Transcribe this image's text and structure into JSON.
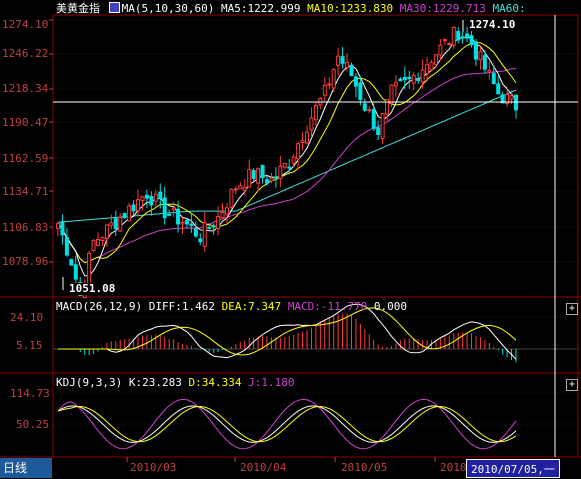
{
  "header": {
    "symbol_name": "美黄金指",
    "ma_label": "MA(5,10,30,60)",
    "ma5": "MA5:1222.999",
    "ma10": "MA10:1233.830",
    "ma30": "MA30:1229.713",
    "ma60": "MA60:"
  },
  "macd_header": {
    "name": "MACD(26,12,9)",
    "diff": "DIFF:1.462",
    "dea": "DEA:7.347",
    "macd": "MACD:-11.770",
    "extra": "0.000"
  },
  "kdj_header": {
    "name": "KDJ(9,3,3)",
    "k": "K:23.283",
    "d": "D:34.334",
    "j": "J:1.180"
  },
  "price_axis": [
    "1274.10",
    "1246.22",
    "1218.34",
    "1190.47",
    "1162.59",
    "1134.71",
    "1106.83",
    "1078.96"
  ],
  "macd_axis": [
    "24.10",
    "5.15"
  ],
  "kdj_axis": [
    "114.73",
    "50.25"
  ],
  "annotations": {
    "high": "1274.10",
    "low": "1051.08"
  },
  "footer": {
    "period": "日线",
    "dates": [
      "2010/03",
      "2010/04",
      "2010/05",
      "2010"
    ],
    "cursor_date": "2010/07/05,一"
  },
  "colors": {
    "up": "#ff3b3b",
    "down": "#00e0e0",
    "ma5": "#ffffff",
    "ma10": "#ffff00",
    "ma30": "#d040d0",
    "ma60": "#40e0e0",
    "grid": "#8b0000",
    "axis": "#c04040"
  }
}
